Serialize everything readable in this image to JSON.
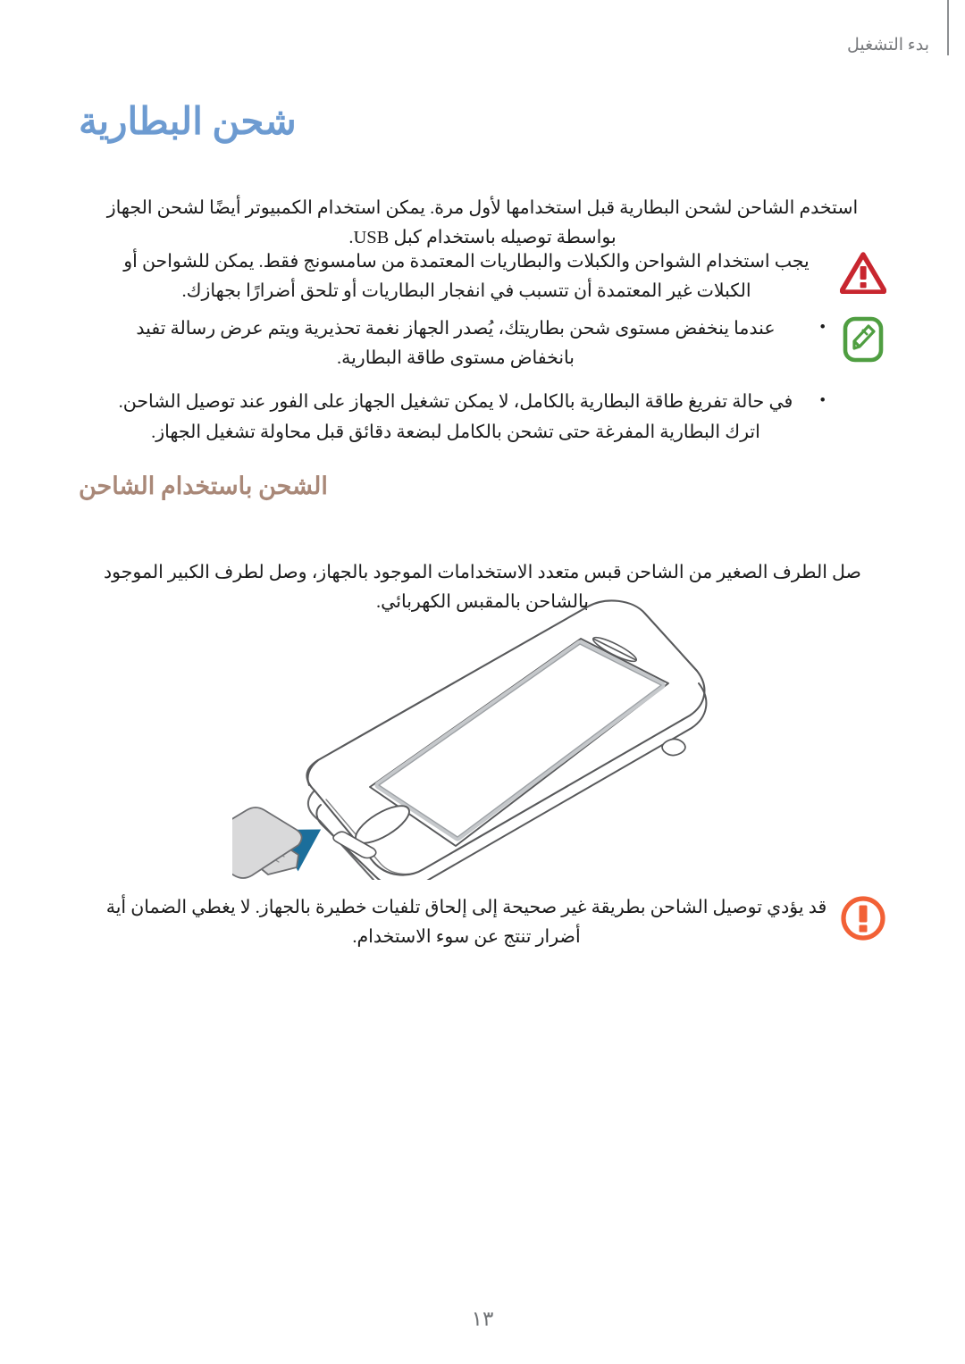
{
  "document": {
    "language": "ar",
    "direction": "rtl",
    "page_number": "١٣"
  },
  "header": {
    "running_title": "بدء التشغيل"
  },
  "headings": {
    "chapter_title": "شحن البطارية",
    "chapter_title_color": "#6d9bd1",
    "sub_heading": "الشحن باستخدام الشاحن",
    "sub_heading_color": "#a98878"
  },
  "paragraphs": {
    "intro": "استخدم الشاحن لشحن البطارية قبل استخدامها لأول مرة. يمكن استخدام الكمبيوتر أيضًا لشحن الجهاز بواسطة توصيله باستخدام كبل USB.",
    "charger_steps": "صل الطرف الصغير من الشاحن قبس متعدد الاستخدامات الموجود بالجهاز، وصل لطرف الكبير الموجود بالشاحن بالمقبس الكهربائي."
  },
  "callouts": [
    {
      "id": "warning",
      "icon": "warning-triangle-icon",
      "icon_color": "#c8262f",
      "text": "يجب استخدام الشواحن والكبلات والبطاريات المعتمدة من سامسونج فقط. يمكن للشواحن أو الكبلات غير المعتمدة أن تتسبب في انفجار البطاريات أو تلحق أضرارًا بجهازك."
    },
    {
      "id": "note",
      "icon": "note-pencil-icon",
      "icon_color": "#4f9e41",
      "bullets": [
        "عندما ينخفض مستوى شحن بطاريتك، يُصدر الجهاز نغمة تحذيرية ويتم عرض رسالة تفيد بانخفاض مستوى طاقة البطارية.",
        "في حالة تفريغ طاقة البطارية بالكامل، لا يمكن تشغيل الجهاز على الفور عند توصيل الشاحن. اترك البطارية المفرغة حتى تشحن بالكامل لبضعة دقائق قبل محاولة تشغيل الجهاز."
      ]
    },
    {
      "id": "caution",
      "icon": "caution-circle-icon",
      "icon_color": "#f26136",
      "text": "قد يؤدي توصيل الشاحن بطريقة غير صحيحة إلى إلحاق تلفيات خطيرة بالجهاز. لا يغطي الضمان أية أضرار تنتج عن سوء الاستخدام."
    }
  ],
  "illustration": {
    "name": "phone-charging-diagram",
    "description": "رسم توضيحي للهاتف وكبل الشحن",
    "arrow_color": "#1b6e9b",
    "cable_color": "#d9d9da",
    "outline_color": "#58595b"
  }
}
